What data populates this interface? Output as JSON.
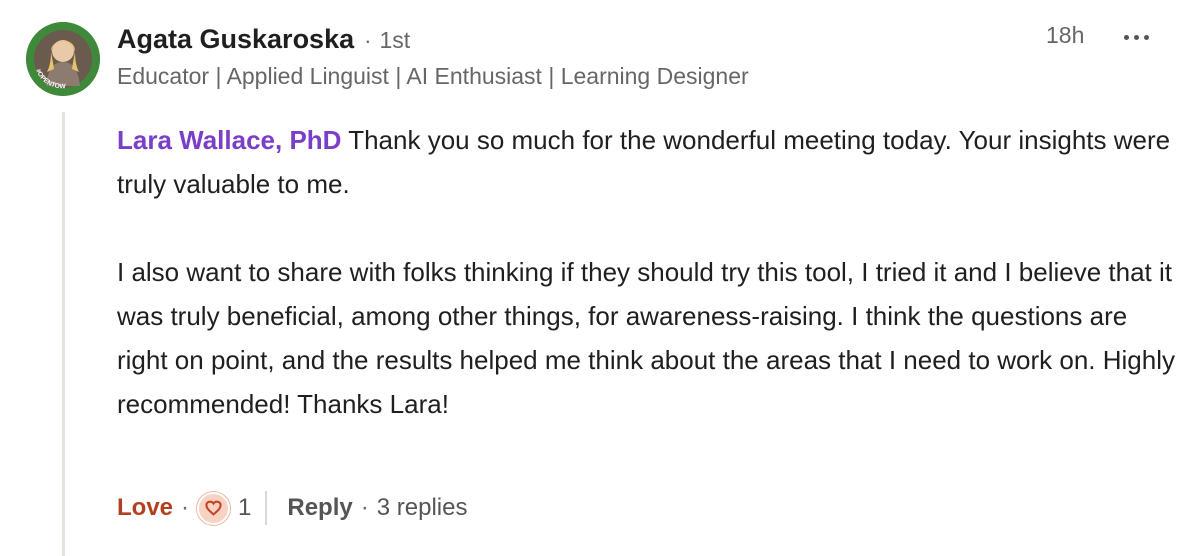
{
  "comment": {
    "author": {
      "name": "Agata Guskaroska",
      "degree": "1st",
      "headline": "Educator | Applied Linguist | AI Enthusiast | Learning Designer",
      "avatar_badge": "#OPENTOWORK"
    },
    "timestamp": "18h",
    "more_icon": "more-horizontal-icon",
    "mention": "Lara Wallace, PhD",
    "paragraph1_rest": " Thank you so much for the wonderful meeting today. Your insights were truly valuable to me.",
    "paragraph2": "I also want to share with folks thinking if they should try this tool, I tried it and I believe that it was truly beneficial, among other things, for awareness-raising. I think the questions are right on point, and the results helped me think about the areas that I need to work on. Highly recommended! Thanks Lara!"
  },
  "actions": {
    "love_label": "Love",
    "separator": "·",
    "reaction_icon": "heart-reaction-icon",
    "reaction_count": "1",
    "reply_label": "Reply",
    "replies_label": "3 replies"
  },
  "colors": {
    "mention": "#7a3ec8",
    "love": "#b24020",
    "secondary_text": "#666666",
    "thread_line": "#e4e2dc",
    "opentowork_green": "#3f8a3a"
  }
}
